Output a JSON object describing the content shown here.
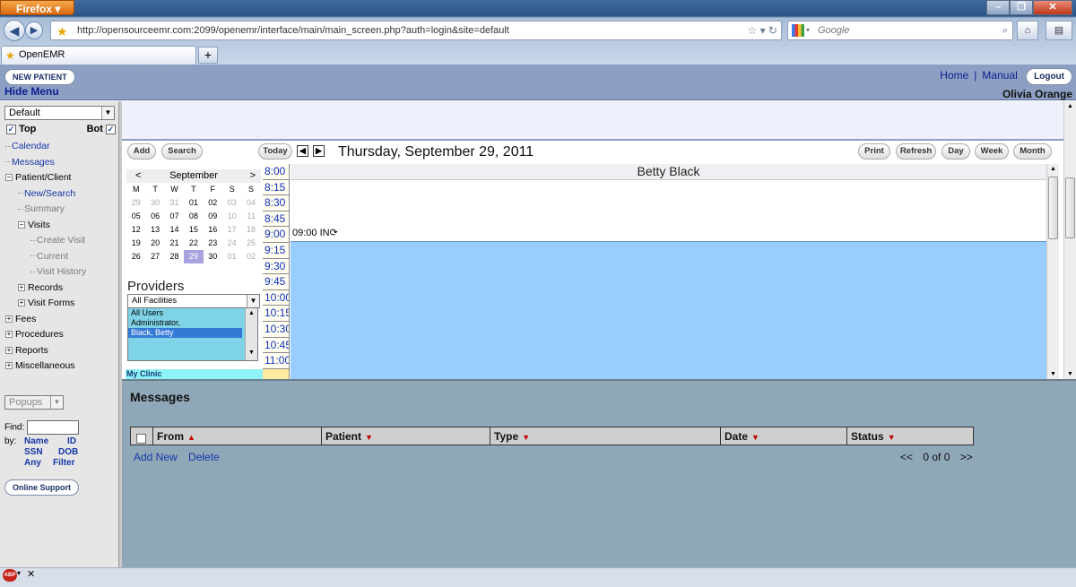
{
  "browser": {
    "menu_label": "Firefox",
    "url": "http://opensourceemr.com:2099/openemr/interface/main/main_screen.php?auth=login&site=default",
    "search_placeholder": "Google",
    "tab_title": "OpenEMR",
    "window_controls": {
      "minimize": "–",
      "restore": "❐",
      "close": "✕"
    }
  },
  "header": {
    "new_patient": "NEW PATIENT",
    "hide_menu": "Hide Menu",
    "home": "Home",
    "separator": "|",
    "manual": "Manual",
    "logout": "Logout",
    "user": "Olivia Orange"
  },
  "left": {
    "layout_select": "Default",
    "top_label": "Top",
    "bot_label": "Bot",
    "top_checked": true,
    "bot_checked": true,
    "tree": [
      {
        "label": "Calendar",
        "type": "link"
      },
      {
        "label": "Messages",
        "type": "link"
      },
      {
        "label": "Patient/Client",
        "type": "folder",
        "expanded": true
      },
      {
        "label": "New/Search",
        "type": "link"
      },
      {
        "label": "Summary",
        "type": "disabled"
      },
      {
        "label": "Visits",
        "type": "folder",
        "expanded": true
      },
      {
        "label": "Create Visit",
        "type": "disabled"
      },
      {
        "label": "Current",
        "type": "disabled"
      },
      {
        "label": "Visit History",
        "type": "disabled"
      },
      {
        "label": "Records",
        "type": "folder",
        "expanded": false
      },
      {
        "label": "Visit Forms",
        "type": "folder",
        "expanded": false
      },
      {
        "label": "Fees",
        "type": "folder",
        "expanded": false
      },
      {
        "label": "Procedures",
        "type": "folder",
        "expanded": false
      },
      {
        "label": "Reports",
        "type": "folder",
        "expanded": false
      },
      {
        "label": "Miscellaneous",
        "type": "folder",
        "expanded": false
      }
    ],
    "popups_select": "Popups",
    "find_label": "Find:",
    "by_label": "by:",
    "find_options": [
      "Name",
      "ID",
      "SSN",
      "DOB",
      "Any",
      "Filter"
    ],
    "online_support": "Online Support"
  },
  "calendar": {
    "buttons": {
      "add": "Add",
      "search": "Search",
      "today": "Today",
      "print": "Print",
      "refresh": "Refresh",
      "day": "Day",
      "week": "Week",
      "month": "Month"
    },
    "date_title": "Thursday, September 29, 2011",
    "mini": {
      "month": "September",
      "prev": "<",
      "next": ">",
      "dow": [
        "M",
        "T",
        "W",
        "T",
        "F",
        "S",
        "S"
      ],
      "weeks": [
        [
          "29",
          "30",
          "31",
          "01",
          "02",
          "03",
          "04"
        ],
        [
          "05",
          "06",
          "07",
          "08",
          "09",
          "10",
          "11"
        ],
        [
          "12",
          "13",
          "14",
          "15",
          "16",
          "17",
          "18"
        ],
        [
          "19",
          "20",
          "21",
          "22",
          "23",
          "24",
          "25"
        ],
        [
          "26",
          "27",
          "28",
          "29",
          "30",
          "01",
          "02"
        ]
      ],
      "selected": "29"
    },
    "providers_title": "Providers",
    "facility_select": "All Facilities",
    "providers": [
      "All Users",
      "Administrator,",
      "Black, Betty"
    ],
    "selected_provider": "Black, Betty",
    "clinic": "My Clinic",
    "provider_column": "Betty Black",
    "times": [
      "8:00",
      "8:15",
      "8:30",
      "8:45",
      "9:00",
      "9:15",
      "9:30",
      "9:45",
      "10:00",
      "10:15",
      "10:30",
      "10:45",
      "11:00"
    ],
    "appointment": "09:00 IN"
  },
  "messages": {
    "title": "Messages",
    "columns": [
      "From",
      "Patient",
      "Type",
      "Date",
      "Status"
    ],
    "add_new": "Add New",
    "delete": "Delete",
    "pager": {
      "prev": "<<",
      "count": "0 of 0",
      "next": ">>"
    }
  },
  "colors": {
    "header_bg": "#8e9fc4",
    "schedule_blue": "#99ccff",
    "message_panel": "#8fa8b8"
  }
}
